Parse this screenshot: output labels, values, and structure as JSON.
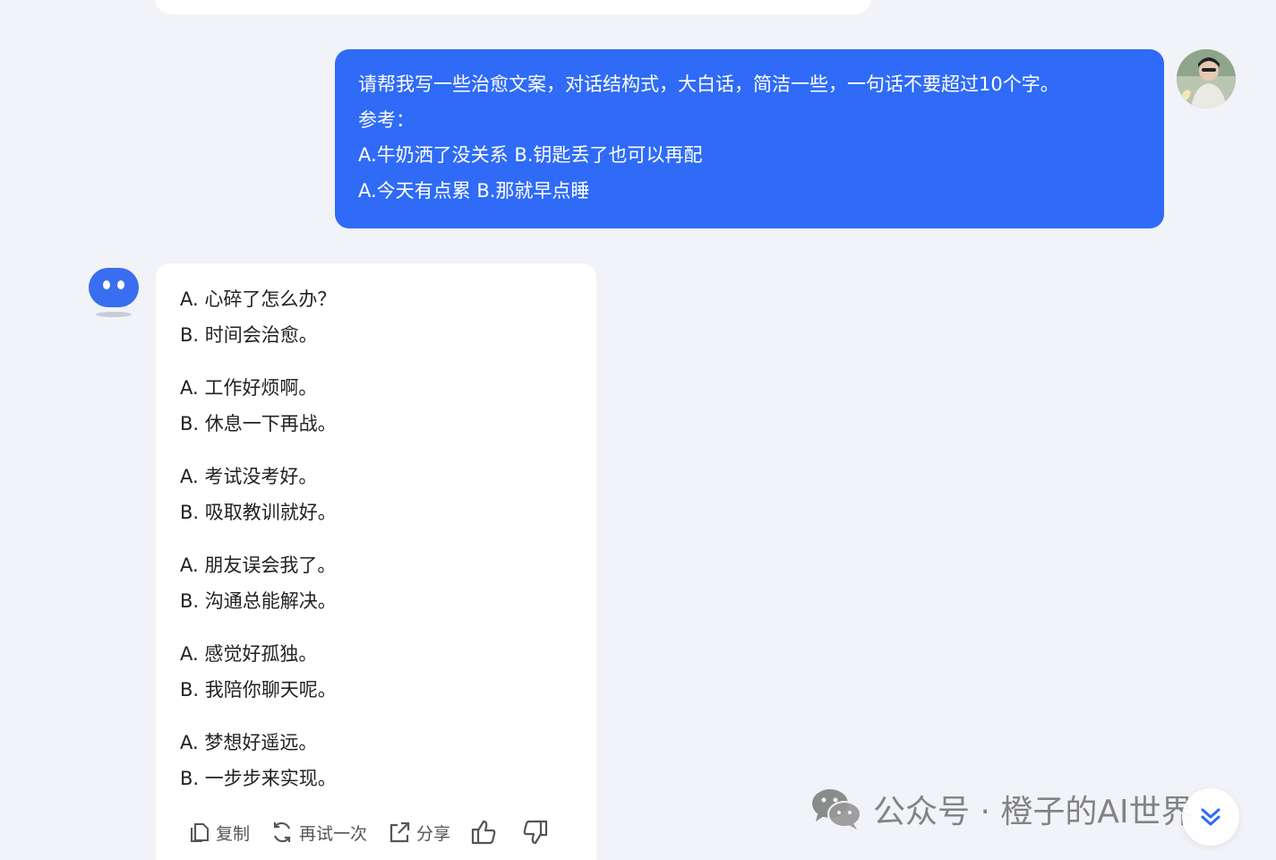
{
  "user_message": {
    "lines": [
      "请帮我写一些治愈文案，对话结构式，大白话，简洁一些，一句话不要超过10个字。",
      "参考：",
      "A.牛奶洒了没关系 B.钥匙丢了也可以再配",
      "A.今天有点累 B.那就早点睡"
    ]
  },
  "bot_reply": {
    "pairs": [
      {
        "a": "A. 心碎了怎么办？",
        "b": "B. 时间会治愈。"
      },
      {
        "a": "A. 工作好烦啊。",
        "b": "B. 休息一下再战。"
      },
      {
        "a": "A. 考试没考好。",
        "b": "B. 吸取教训就好。"
      },
      {
        "a": "A. 朋友误会我了。",
        "b": "B. 沟通总能解决。"
      },
      {
        "a": "A. 感觉好孤独。",
        "b": "B. 我陪你聊天呢。"
      },
      {
        "a": "A. 梦想好遥远。",
        "b": "B. 一步步来实现。"
      }
    ]
  },
  "actions": {
    "copy_label": "复制",
    "retry_label": "再试一次",
    "share_label": "分享"
  },
  "watermark": {
    "text": "公众号 · 橙子的AI世界"
  },
  "icons": {
    "copy": "copy-icon",
    "retry": "refresh-icon",
    "share": "share-icon",
    "like": "thumbs-up-icon",
    "dislike": "thumbs-down-icon",
    "wechat": "wechat-icon",
    "scroll": "double-chevron-down-icon"
  },
  "colors": {
    "accent": "#2f6bf6",
    "background": "#f2f3f8",
    "bubble": "#ffffff"
  }
}
